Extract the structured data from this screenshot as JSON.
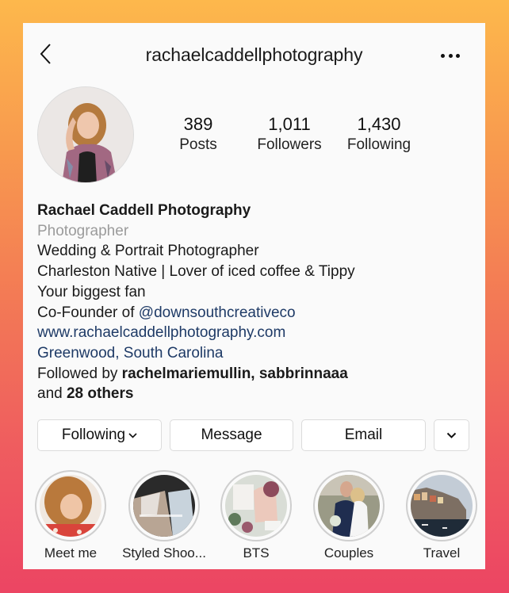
{
  "header": {
    "username": "rachaelcaddellphotography",
    "back_icon": "chevron-left-icon",
    "more_icon": "more-horizontal-icon"
  },
  "profile": {
    "avatar_icon": "profile-photo",
    "stats": [
      {
        "value": "389",
        "label": "Posts"
      },
      {
        "value": "1,011",
        "label": "Followers"
      },
      {
        "value": "1,430",
        "label": "Following"
      }
    ]
  },
  "bio": {
    "name": "Rachael Caddell Photography",
    "category": "Photographer",
    "lines": [
      "Wedding & Portrait Photographer",
      "Charleston Native | Lover of iced coffee & Tippy",
      "Your biggest fan"
    ],
    "cofounder_prefix": "Co-Founder of ",
    "cofounder_mention": "@downsouthcreativeco",
    "website": "www.rachaelcaddellphotography.com",
    "location": "Greenwood, South Carolina",
    "followed_by_prefix": "Followed by ",
    "followed_by_users": "rachelmariemullin, sabbrinnaaa",
    "followed_by_and": "and ",
    "followed_by_others": "28 others"
  },
  "actions": {
    "following_label": "Following",
    "message_label": "Message",
    "email_label": "Email",
    "dropdown_icon": "chevron-down-icon"
  },
  "highlights": [
    {
      "label": "Meet me"
    },
    {
      "label": "Styled Shoo..."
    },
    {
      "label": "BTS"
    },
    {
      "label": "Couples"
    },
    {
      "label": "Travel"
    }
  ],
  "colors": {
    "link": "#1e3a66",
    "category": "#9b9b9b",
    "gradient_top": "#fdb84c",
    "gradient_bottom": "#ec4563"
  }
}
